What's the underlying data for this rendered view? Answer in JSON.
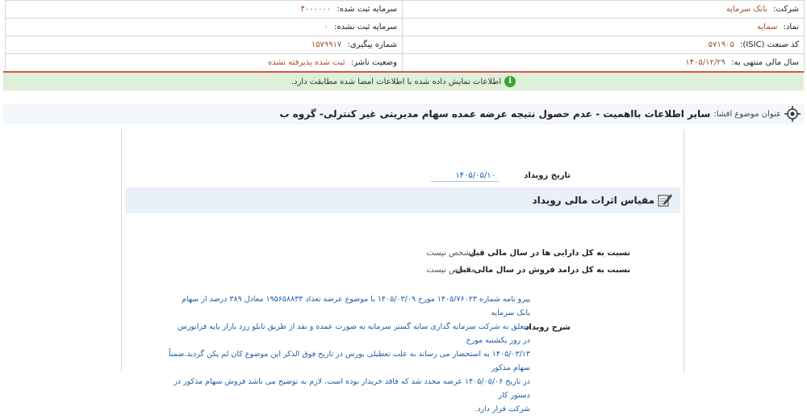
{
  "header": {
    "company_label": "شرکت:",
    "company_value": "بانک سرمایه",
    "registered_capital_label": "سرمایه ثبت شده:",
    "registered_capital_value": "۴۰۰۰۰۰۰",
    "symbol_label": "نماد:",
    "symbol_value": "سمایه",
    "unregistered_capital_label": "سرمایه ثبت نشده:",
    "unregistered_capital_value": "۰",
    "isic_label": "کد صنعت (ISIC):",
    "isic_value": "۵۷۱۹۰۵",
    "tracking_label": "شماره پیگیری:",
    "tracking_value": "۱۵۷۹۹۱۷",
    "fiscal_label": "سال مالی منتهی به:",
    "fiscal_value": "۱۴۰۵/۱۲/۲۹",
    "status_label": "وضعیت ناشر:",
    "status_value": "ثبت شده پذیرفته نشده"
  },
  "notice": {
    "icon": "info-icon",
    "text": "اطلاعات نمایش داده شده با اطلاعات امضا شده مطابقت دارد."
  },
  "subject": {
    "icon": "target-icon",
    "label": "عنوان موضوع افشا:",
    "title": "سایر اطلاعات بااهمیت - عدم حصول نتیجه عرضه عمده سهام مدیریتی غیر کنترلی- گروه ب"
  },
  "event": {
    "date_label": "تاریخ رویداد",
    "date_value": "۱۴۰۵/۰۵/۱۰"
  },
  "section": {
    "icon": "edit-icon",
    "title": "مقیاس اثرات مالی رویداد"
  },
  "ratios": [
    {
      "label": "نسبت به کل دارایی ها در سال مالی قبل",
      "value": "مشخص نیست"
    },
    {
      "label": "نسبت به کل درامد فروش در سال مالی قبل",
      "value": "مشخص نیست"
    }
  ],
  "description": {
    "label": "شرح رویداد",
    "lines": [
      "پیرو نامه شماره ۱۴۰۵/۷۶۰۲۳ مورخ ۱۴۰۵/۰۳/۰۹ با موضوع عرضه تعداد ۱۹۵۶۵۸۸۳۳ معادل ۳۸۹ درصد از سهام بانک سرمایه",
      "متعلق به شرکت سرمایه گذاری سایه گستر سرمایه به صورت عمده و نقد از طریق تابلو زرد بازار پایه فرابورس در روز یکشنبه مورخ",
      "۱۴۰۵/۰۳/۱۳ به استحضار می رساند به علت تعطیلی بورس در تاریخ فوق الذکر این موضوع کان لم یکن گردید.ضمناً سهام مذکور",
      "در تاریخ ۱۴۰۵/۰۵/۰۶ عرضه مجدد شد که فاقد خریدار بوده است. لازم به توضیح می باشد فروش سهام مذکور در دستور کار",
      "شرکت قرار دارد."
    ]
  }
}
